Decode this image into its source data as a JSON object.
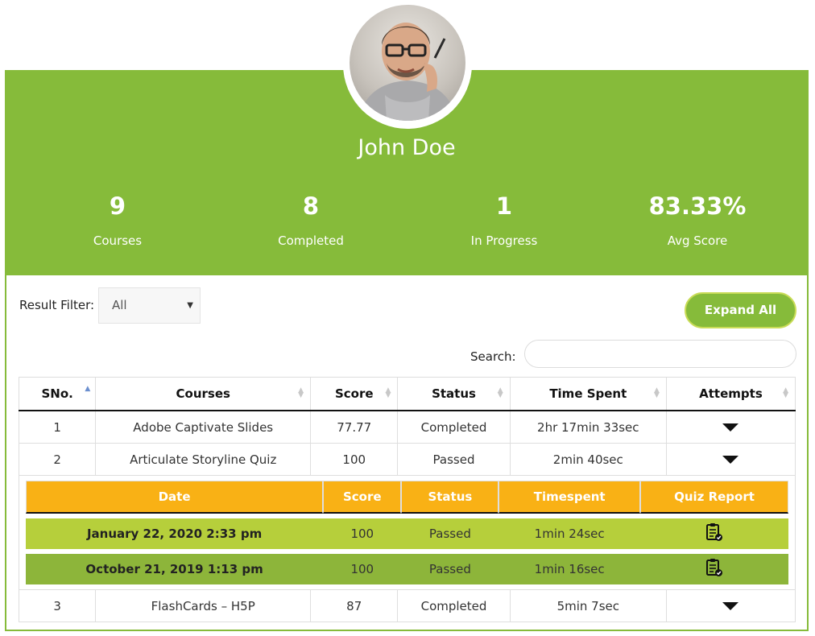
{
  "profile": {
    "name": "John Doe",
    "stats": [
      {
        "value": "9",
        "label": "Courses"
      },
      {
        "value": "8",
        "label": "Completed"
      },
      {
        "value": "1",
        "label": "In Progress"
      },
      {
        "value": "83.33%",
        "label": "Avg Score"
      }
    ]
  },
  "controls": {
    "filter_label": "Result Filter:",
    "filter_value": "All",
    "expand_label": "Expand All",
    "search_label": "Search:",
    "search_value": ""
  },
  "table": {
    "headers": [
      "SNo.",
      "Courses",
      "Score",
      "Status",
      "Time Spent",
      "Attempts"
    ],
    "rows": [
      {
        "sno": "1",
        "course": "Adobe Captivate Slides",
        "score": "77.77",
        "status": "Completed",
        "time": "2hr 17min 33sec"
      },
      {
        "sno": "2",
        "course": "Articulate Storyline Quiz",
        "score": "100",
        "status": "Passed",
        "time": "2min 40sec"
      },
      {
        "sno": "3",
        "course": "FlashCards – H5P",
        "score": "87",
        "status": "Completed",
        "time": "5min 7sec"
      }
    ]
  },
  "attempts": {
    "headers": [
      "Date",
      "Score",
      "Status",
      "Timespent",
      "Quiz Report"
    ],
    "rows": [
      {
        "date": "January 22, 2020 2:33 pm",
        "score": "100",
        "status": "Passed",
        "time": "1min 24sec"
      },
      {
        "date": "October 21, 2019 1:13 pm",
        "score": "100",
        "status": "Passed",
        "time": "1min 16sec"
      }
    ]
  },
  "icons": {
    "sort": "sort-icon",
    "expand_row": "caret-down-icon",
    "quiz_report": "clipboard-check-icon"
  },
  "colors": {
    "brand_green": "#86bb3a",
    "accent_orange": "#f9b115",
    "attempt_row_light": "#b6cf3b",
    "attempt_row_dark": "#8db53a"
  }
}
